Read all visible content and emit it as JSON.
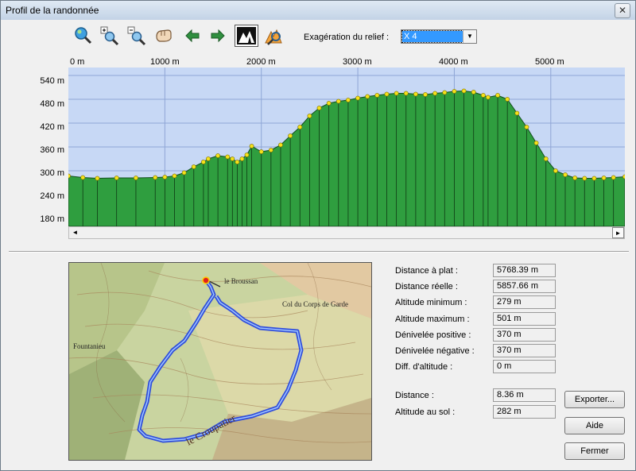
{
  "window": {
    "title": "Profil de la randonnée",
    "close_glyph": "✕"
  },
  "toolbar": {
    "buttons": [
      {
        "icon": "zoom-fit-icon"
      },
      {
        "icon": "zoom-in-icon"
      },
      {
        "icon": "zoom-out-icon"
      },
      {
        "icon": "pan-hand-icon"
      },
      {
        "icon": "arrow-left-icon"
      },
      {
        "icon": "arrow-right-icon"
      },
      {
        "icon": "relief-mode-icon",
        "pressed": true
      },
      {
        "icon": "profile-tool-icon"
      }
    ],
    "relief_label": "Exagération du relief :",
    "relief_value": "X 4"
  },
  "chart_data": {
    "type": "area",
    "x_ticks": [
      "0 m",
      "1000 m",
      "2000 m",
      "3000 m",
      "4000 m",
      "5000 m"
    ],
    "y_ticks": [
      "540 m",
      "480 m",
      "420 m",
      "360 m",
      "300 m",
      "240 m",
      "180 m"
    ],
    "xlim": [
      0,
      5768
    ],
    "ylim": [
      160,
      560
    ],
    "x": [
      0,
      150,
      300,
      500,
      700,
      900,
      1000,
      1100,
      1200,
      1300,
      1400,
      1450,
      1550,
      1650,
      1700,
      1750,
      1800,
      1850,
      1900,
      2000,
      2100,
      2200,
      2300,
      2400,
      2500,
      2600,
      2700,
      2800,
      2900,
      3000,
      3100,
      3200,
      3300,
      3400,
      3500,
      3600,
      3700,
      3800,
      3900,
      4000,
      4100,
      4200,
      4300,
      4350,
      4450,
      4550,
      4650,
      4750,
      4850,
      4950,
      5050,
      5150,
      5250,
      5350,
      5450,
      5550,
      5650,
      5768
    ],
    "y": [
      287,
      283,
      281,
      282,
      282,
      283,
      284,
      287,
      295,
      310,
      322,
      330,
      338,
      335,
      330,
      322,
      330,
      340,
      362,
      348,
      352,
      365,
      388,
      410,
      438,
      458,
      470,
      475,
      478,
      483,
      487,
      490,
      493,
      495,
      495,
      493,
      492,
      495,
      497,
      500,
      501,
      498,
      490,
      485,
      490,
      480,
      445,
      410,
      370,
      330,
      300,
      290,
      282,
      281,
      281,
      282,
      283,
      285
    ],
    "fill": "#2f9e3f",
    "plot_bg": "#c7d8f5",
    "point_color": "#f5e21a"
  },
  "map": {
    "place_labels": [
      "le Broussan",
      "Col du Corps de Garde",
      "Fountanieu",
      "le Croupatier"
    ]
  },
  "stats": [
    {
      "label": "Distance à plat :",
      "value": "5768.39 m"
    },
    {
      "label": "Distance réelle :",
      "value": "5857.66 m"
    },
    {
      "label": "Altitude minimum :",
      "value": "279 m"
    },
    {
      "label": "Altitude maximum :",
      "value": "501 m"
    },
    {
      "label": "Dénivelée positive :",
      "value": "370 m"
    },
    {
      "label": "Dénivelée négative :",
      "value": "370 m"
    },
    {
      "label": "Diff. d'altitude :",
      "value": "0 m"
    }
  ],
  "cursor": [
    {
      "label": "Distance :",
      "value": "8.36 m"
    },
    {
      "label": "Altitude au sol :",
      "value": "282 m"
    }
  ],
  "buttons": {
    "export": "Exporter...",
    "help": "Aide",
    "close": "Fermer"
  },
  "scrollbar": {
    "left_glyph": "◄",
    "right_glyph": "►"
  },
  "select_glyph": "▼"
}
